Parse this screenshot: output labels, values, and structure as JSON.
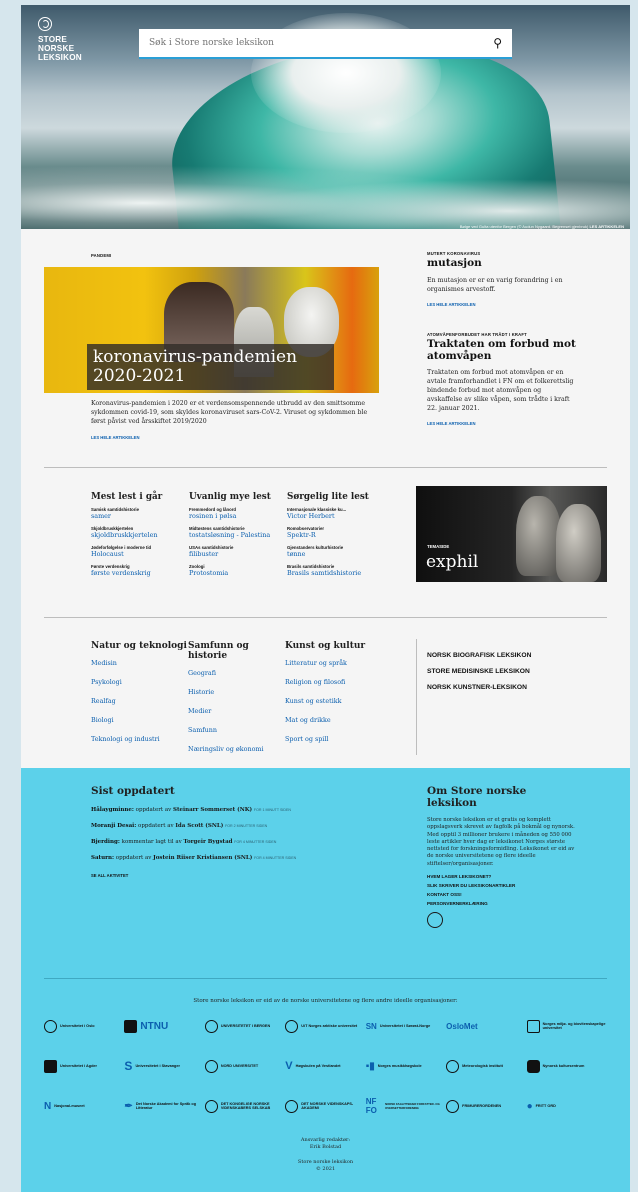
{
  "logo": {
    "lines": [
      "STORE",
      "NORSKE",
      "LEKSIKON"
    ]
  },
  "search": {
    "placeholder": "Søk i Store norske leksikon"
  },
  "hero_caption": {
    "text": "Bølge ved Gulta utenfor Bergen (© Audun Nygaard. Begrenset gjenbruk)",
    "link": "LES ARTIKKELEN"
  },
  "featured": {
    "kicker": "PANDEMI",
    "title": "koronavirus-pandemien 2020-2021",
    "lede": "Koronavirus-pandemien i 2020 er et verdensomspennende utbrudd av den smittsomme sykdommen covid-19, som skyldes koronaviruset sars-CoV-2. Viruset og sykdommen ble først påvist ved årsskiftet 2019/2020",
    "more": "LES HELE ARTIKKELEN"
  },
  "side_articles": [
    {
      "kicker": "MUTERT KORONAVIRUS",
      "title": "mutasjon",
      "text": "En mutasjon er er en varig forandring i en organismes arvestoff.",
      "more": "LES HELE ARTIKKELEN"
    },
    {
      "kicker": "ATOMVÅPENFORBUDET HAR TRÅDT I KRAFT",
      "title": "Traktaten om forbud mot atomvåpen",
      "text": "Traktaten om forbud mot atomvåpen er en avtale framforhandlet i FN om et folkerettslig bindende forbud mot atomvåpen og avskaffelse av slike våpen, som trådte i kraft 22. januar 2021.",
      "more": "LES HELE ARTIKKELEN"
    }
  ],
  "lists": [
    {
      "title": "Mest lest i går",
      "items": [
        {
          "k": "Samisk samtidshistorie",
          "l": "samer"
        },
        {
          "k": "Skjoldbruskkjertelen",
          "l": "skjoldbruskkjertelen"
        },
        {
          "k": "Jødeforfølgelse i moderne tid",
          "l": "Holocaust"
        },
        {
          "k": "Første verdenskrig",
          "l": "første verdenskrig"
        }
      ]
    },
    {
      "title": "Uvanlig mye lest",
      "items": [
        {
          "k": "Fremmedord og lånord",
          "l": "rosinen i pølsa"
        },
        {
          "k": "Midtøstens samtidshistorie",
          "l": "tostatsløsning - Palestina"
        },
        {
          "k": "USAs samtidshistorie",
          "l": "filibuster"
        },
        {
          "k": "Zoologi",
          "l": "Protostomia"
        }
      ]
    },
    {
      "title": "Sørgelig lite lest",
      "items": [
        {
          "k": "Internasjonale klassiske ku...",
          "l": "Victor Herbert"
        },
        {
          "k": "Romobservatorier",
          "l": "Spektr-R"
        },
        {
          "k": "Gjenstanders kulturhistorie",
          "l": "tønne"
        },
        {
          "k": "Brasils samtidshistorie",
          "l": "Brasils samtidshistorie"
        }
      ]
    }
  ],
  "exphil": {
    "kicker": "TEMASIDE",
    "title": "exphil"
  },
  "categories": [
    {
      "title": "Natur og teknologi",
      "links": [
        "Medisin",
        "Psykologi",
        "Realfag",
        "Biologi",
        "Teknologi og industri"
      ]
    },
    {
      "title": "Samfunn og historie",
      "links": [
        "Geografi",
        "Historie",
        "Medier",
        "Samfunn",
        "Næringsliv og økonomi"
      ]
    },
    {
      "title": "Kunst og kultur",
      "links": [
        "Litteratur og språk",
        "Religion og filosofi",
        "Kunst og estetikk",
        "Mat og drikke",
        "Sport og spill"
      ]
    }
  ],
  "other_lexica": [
    "NORSK BIOGRAFISK LEKSIKON",
    "STORE MEDISINSKE LEKSIKON",
    "NORSK KUNSTNER-LEKSIKON"
  ],
  "activity": {
    "title": "Sist oppdatert",
    "rows": [
      {
        "a": "Hålaygminne:",
        "b": "oppdatert av",
        "c": "Steinarr Sommerset (NK)",
        "d": "FOR 1 MINUTT SIDEN"
      },
      {
        "a": "Moranji Desai:",
        "b": "oppdatert av",
        "c": "Ida Scott (SNL)",
        "d": "FOR 2 MINUTTER SIDEN"
      },
      {
        "a": "Bjerding:",
        "b": "kommentar lagt til av",
        "c": "Torgeir Bygstad",
        "d": "FOR 4 MINUTTER SIDEN"
      },
      {
        "a": "Saturn:",
        "b": "oppdatert av",
        "c": "Jostein Riiser Kristiansen (SNL)",
        "d": "FOR 4 MINUTTER SIDEN"
      }
    ],
    "more": "SE ALL AKTIVITET"
  },
  "about": {
    "title": "Om Store norske leksikon",
    "text": "Store norske leksikon er et gratis og komplett oppslagsverk skrevet av fagfolk på bokmål og nynorsk. Med opptil 3 millioner brukere i måneden og 550 000 leste artikler hver dag er leksikonet Norges største nettsted for forskningsformidling. Leksikonet er eid av de norske universitetene og flere ideelle stiftelser/organisasjoner.",
    "links": [
      "HVEM LAGER LEKSIKONET?",
      "SLIK SKRIVER DU LEKSIKONARTIKLER",
      "KONTAKT OSS!",
      "PERSONVERNERKLÆRING"
    ]
  },
  "owners": {
    "line": "Store norske leksikon er eid av de norske universitetene og flere andre ideelle organisasjoner:",
    "logos": [
      "Universitetet i Oslo",
      "NTNU",
      "UNIVERSITETET I BERGEN",
      "UiT Norges arktiske universitet",
      "Universitetet i Sørøst-Norge",
      "OsloMet",
      "Norges miljø- og biovitenskapelige universitet",
      "Universitetet i Agder",
      "Universitetet i Stavanger",
      "NORD UNIVERSITET",
      "Høgskulen på Vestlandet",
      "Norges musikkhøgskole",
      "Meteorologisk institutt",
      "Nynorsk kultursentrum",
      "Nasjonal-museet",
      "Det Norske Akademi for Språk og Litteratur",
      "DET KONGELIGE NORSKE VIDENSKABERS SELSKAB",
      "DET NORSKE VIDENSKAPS-AKADEMI",
      "NORSK FAGLITTERÆR FORFATTER- OG OVERSETTERFORENING",
      "FRIMURERORDENEN",
      "FRITT ORD"
    ]
  },
  "credit": {
    "editor_label": "Ansvarlig redaktør:",
    "editor": "Erik Bolstad",
    "site": "Store norske leksikon",
    "year": "© 2021"
  }
}
